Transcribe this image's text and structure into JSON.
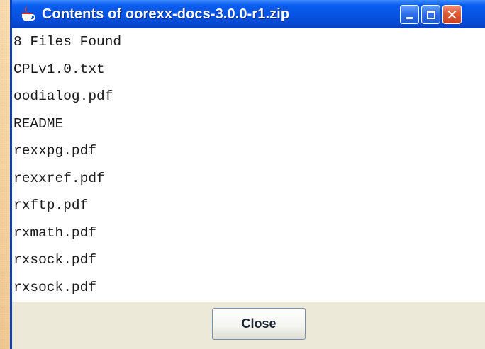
{
  "window": {
    "title": "Contents of oorexx-docs-3.0.0-r1.zip",
    "icon": "java-coffee-cup-icon",
    "controls": {
      "minimize": "minimize-icon",
      "maximize": "maximize-icon",
      "close": "close-icon",
      "close_glyph": "✕"
    }
  },
  "list": {
    "items": [
      "8 Files Found",
      "CPLv1.0.txt",
      "oodialog.pdf",
      "README",
      "rexxpg.pdf",
      "rexxref.pdf",
      "rxftp.pdf",
      "rxmath.pdf",
      "rxsock.pdf",
      "rxsock.pdf"
    ]
  },
  "footer": {
    "close_label": "Close"
  },
  "colors": {
    "titlebar": "#0753e2",
    "desktop": "#f3cf98",
    "content_bg": "#ffffff",
    "footer_bg": "#ece9d8"
  }
}
